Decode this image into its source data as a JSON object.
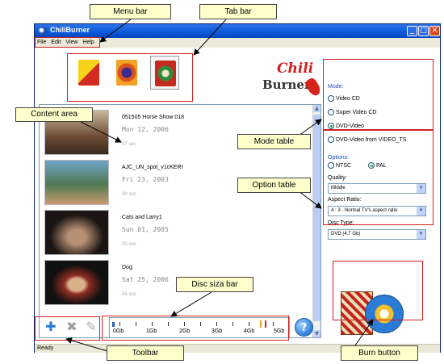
{
  "window": {
    "title": "ChiliBurner",
    "buttons": {
      "minimize": "_",
      "maximize": "□",
      "close": "✕"
    }
  },
  "menu": [
    "File",
    "Edit",
    "View",
    "Help"
  ],
  "tabs": [
    {
      "icon": "data-disc-tab-icon",
      "active": false
    },
    {
      "icon": "audio-disc-tab-icon",
      "active": false
    },
    {
      "icon": "video-disc-tab-icon",
      "active": true
    }
  ],
  "logo": {
    "line1": "Chili",
    "line2": "Burner"
  },
  "items": [
    {
      "name": "051505 Horse Show 018",
      "date": "Mon 12, 2006",
      "duration": "07 sec"
    },
    {
      "name": "AJC_UN_spot_v1cKERI",
      "date": "Fri 23, 2003",
      "duration": "30 sec"
    },
    {
      "name": "Cats and Larry1",
      "date": "Sun 01, 2005",
      "duration": "00 sec"
    },
    {
      "name": "Dog",
      "date": "Sat 25, 2006",
      "duration": "55 sec"
    }
  ],
  "mode": {
    "legend": "Mode:",
    "options": [
      "Video CD",
      "Super Video CD",
      "DVD-Video",
      "DVD-Video from VIDEO_TS"
    ],
    "selected": "DVD-Video"
  },
  "options": {
    "legend": "Options:",
    "standards": [
      "NTSC",
      "PAL"
    ],
    "standard_selected": "PAL",
    "quality_label": "Quality:",
    "quality_value": "Middle",
    "aspect_label": "Aspect Ratio:",
    "aspect_value": "4 : 3 - Normal TV's aspect ratio",
    "disc_label": "Disc Type:",
    "disc_value": "DVD (4.7 Gb)"
  },
  "disc_bar": {
    "labels": [
      "0Gb",
      "1Gb",
      "2Gb",
      "3Gb",
      "4Gb",
      "5Gb"
    ]
  },
  "toolbar": {
    "add_icon": "add-icon",
    "remove_icon": "remove-icon",
    "edit_icon": "edit-icon",
    "help_label": "?"
  },
  "status": "Ready",
  "annotations": {
    "menu_bar": "Menu bar",
    "tab_bar": "Tab bar",
    "content_area": "Content area",
    "mode_table": "Mode table",
    "option_table": "Option table",
    "disc_size_bar": "Disc siza bar",
    "toolbar": "Toolbar",
    "burn_button": "Burn button"
  },
  "colors": {
    "accent": "#0a58d8",
    "annotation_bg": "#ffffcc",
    "annotation_box": "#d02020",
    "logo_red": "#d21f1f"
  }
}
